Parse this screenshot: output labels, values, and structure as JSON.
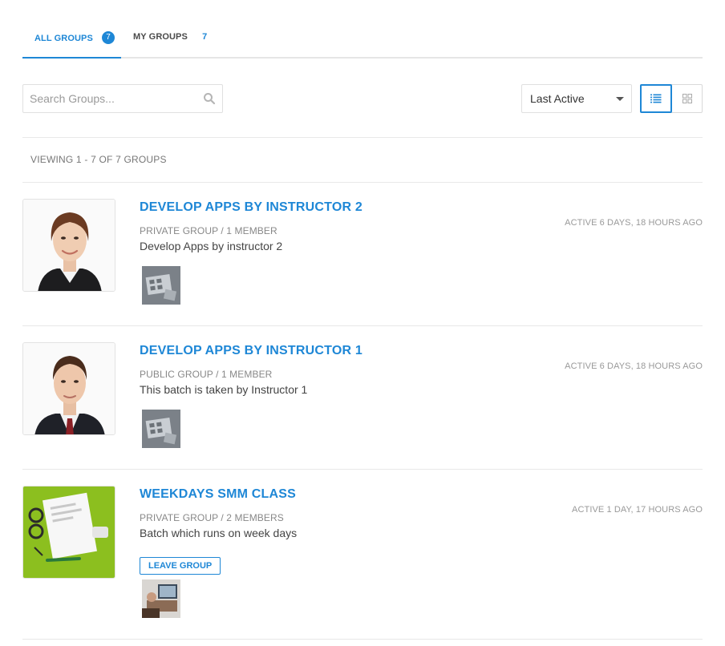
{
  "tabs": {
    "all_label": "All Groups",
    "all_count": "7",
    "my_label": "My Groups",
    "my_count": "7"
  },
  "search": {
    "placeholder": "Search Groups..."
  },
  "sort": {
    "selected": "Last Active"
  },
  "viewing_text": "VIEWING 1 - 7 OF 7 GROUPS",
  "colors": {
    "accent": "#1e87d6",
    "green_avatar": "#8cbf1f"
  },
  "groups": [
    {
      "title": "DEVELOP APPS BY INSTRUCTOR 2",
      "meta": "PRIVATE GROUP / 1 MEMBER",
      "description": "Develop Apps by instructor 2",
      "active": "ACTIVE 6 DAYS, 18 HOURS AGO"
    },
    {
      "title": "DEVELOP APPS BY INSTRUCTOR 1",
      "meta": "PUBLIC GROUP / 1 MEMBER",
      "description": "This batch is taken by Instructor 1",
      "active": "ACTIVE 6 DAYS, 18 HOURS AGO"
    },
    {
      "title": "WEEKDAYS SMM CLASS",
      "meta": "PRIVATE GROUP / 2 MEMBERS",
      "description": "Batch which runs on week days",
      "active": "ACTIVE 1 DAY, 17 HOURS AGO",
      "leave_label": "LEAVE GROUP"
    }
  ]
}
